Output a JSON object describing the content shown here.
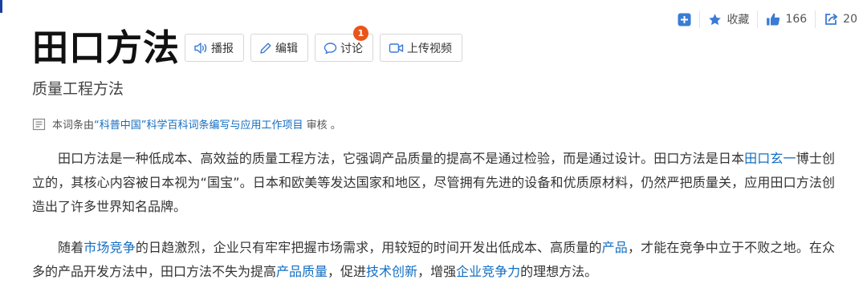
{
  "header": {
    "favorite_label": "收藏",
    "like_count": "166",
    "share_count": "20"
  },
  "entry": {
    "title": "田口方法",
    "subtitle": "质量工程方法"
  },
  "toolbar": {
    "broadcast": "播报",
    "edit": "编辑",
    "discuss": "讨论",
    "discuss_badge": "1",
    "upload_video": "上传视频"
  },
  "review_notice": {
    "prefix": "本词条由",
    "link": "“科普中国”科学百科词条编写与应用工作项目",
    "suffix": " 审核 。"
  },
  "paragraphs": [
    {
      "t1": "田口方法是一种低成本、高效益的质量工程方法，它强调产品质量的提高不是通过检验，而是通过设计。田口方法是日本",
      "link1": "田口玄一",
      "t2": "博士创立的，其核心内容被日本视为“国宝”。日本和欧美等发达国家和地区，尽管拥有先进的设备和优质原材料，仍然严把质量关，应用田口方法创造出了许多世界知名品牌。"
    },
    {
      "t1": "随着",
      "link1": "市场竞争",
      "t2": "的日趋激烈，企业只有牢牢把握市场需求，用较短的时间开发出低成本、高质量的",
      "link2": "产品",
      "t3": "，才能在竞争中立于不败之地。在众多的产品开发方法中，田口方法不失为提高",
      "link3": "产品质量",
      "t4": "，促进",
      "link4": "技术创新",
      "t5": "，增强",
      "link5": "企业竞争力",
      "t6": "的理想方法。"
    }
  ],
  "colors": {
    "link": "#136ec2",
    "icon_blue": "#3a7bd5",
    "badge": "#e9541b"
  }
}
